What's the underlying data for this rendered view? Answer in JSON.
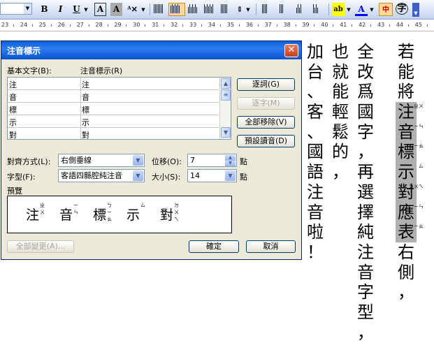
{
  "dialog": {
    "title": "注音標示",
    "close": "✕",
    "base_text_label": "基本文字(B):",
    "phonetic_label": "注音標示(R)",
    "rows": [
      {
        "base": "注",
        "ruby": "注"
      },
      {
        "base": "音",
        "ruby": "音"
      },
      {
        "base": "標",
        "ruby": "標"
      },
      {
        "base": "示",
        "ruby": "示"
      },
      {
        "base": "對",
        "ruby": "對"
      }
    ],
    "btn_by_word": "逐詞(G)",
    "btn_by_char": "逐字(M)",
    "btn_remove_all": "全部移除(V)",
    "btn_default_reading": "預設讀音(D)",
    "alignment_label": "對齊方式(L):",
    "alignment_value": "右側垂線",
    "offset_label": "位移(O):",
    "offset_value": "7",
    "offset_unit": "點",
    "font_label": "字型(F):",
    "font_value": "客語四縣腔純注音",
    "size_label": "大小(S):",
    "size_value": "14",
    "size_unit": "點",
    "preview_label": "預覽",
    "preview_chars": [
      {
        "ch": "注",
        "zy": "ㄓㄨ"
      },
      {
        "ch": "音",
        "zy": "ㄧㄣ"
      },
      {
        "ch": "標",
        "zy": "ㄅㄧㄠ"
      },
      {
        "ch": "示",
        "zy": "ㄙ"
      },
      {
        "ch": "對",
        "zy": "ㄉㄨㄟ"
      }
    ],
    "btn_apply_all": "全部變更(A)...",
    "btn_ok": "確定",
    "btn_cancel": "取消"
  },
  "ruler": {
    "labels": [
      "23",
      "24",
      "25",
      "26",
      "27",
      "28",
      "29",
      "30",
      "31",
      "32",
      "33",
      "34",
      "35",
      "36",
      "37",
      "38",
      "39",
      "40",
      "41",
      "42",
      "43",
      "44",
      "45"
    ]
  },
  "document": {
    "columns": [
      {
        "chars": [
          "若",
          "能",
          "將",
          "注",
          "音",
          "標",
          "示",
          "對",
          "應",
          "表",
          "右",
          "側",
          "，"
        ],
        "selected_from": 3,
        "selected_to": 9,
        "zhuyin": {
          "3": "ㄓㄨ",
          "4": "ㄧㄣ",
          "5": "ㄅㄧㄠ",
          "6": "ㄙ",
          "7": "ㄉㄨㄟ",
          "8": "ㄧㄣ",
          "9": "ㄅㄧㄠ"
        }
      },
      {
        "chars": [
          "全",
          "改",
          "爲",
          "國",
          "字",
          "，",
          "再",
          "選",
          "擇",
          "純",
          "注",
          "音",
          "字",
          "型",
          "，"
        ]
      },
      {
        "chars": [
          "也",
          "就",
          "能",
          "輕",
          "鬆",
          "的",
          "，"
        ]
      },
      {
        "chars": [
          "加",
          "台",
          "、",
          "客",
          "、",
          "國",
          "語",
          "注",
          "音",
          "啦",
          "！"
        ]
      }
    ]
  }
}
